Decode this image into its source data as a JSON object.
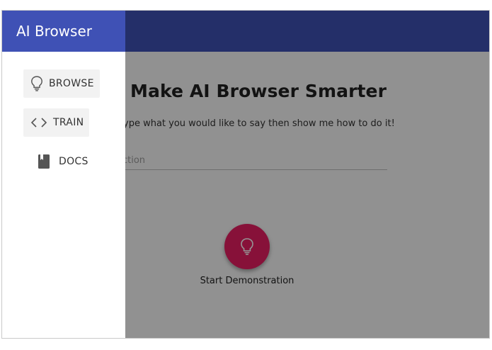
{
  "app": {
    "title": "AI Browser"
  },
  "nav": [
    {
      "label": "BROWSE",
      "icon": "lightbulb-icon"
    },
    {
      "label": "TRAIN",
      "icon": "code-icon"
    },
    {
      "label": "DOCS",
      "icon": "book-icon"
    }
  ],
  "main": {
    "title": "Make AI Browser Smarter",
    "subtitle": "ype what you would like to say then show me how to do it!",
    "input_placeholder": "ction",
    "demo_button": {
      "label": "Start Demonstration",
      "icon": "lightbulb-icon"
    }
  },
  "colors": {
    "primary": "#3f51b5",
    "accent": "#e91e63"
  }
}
